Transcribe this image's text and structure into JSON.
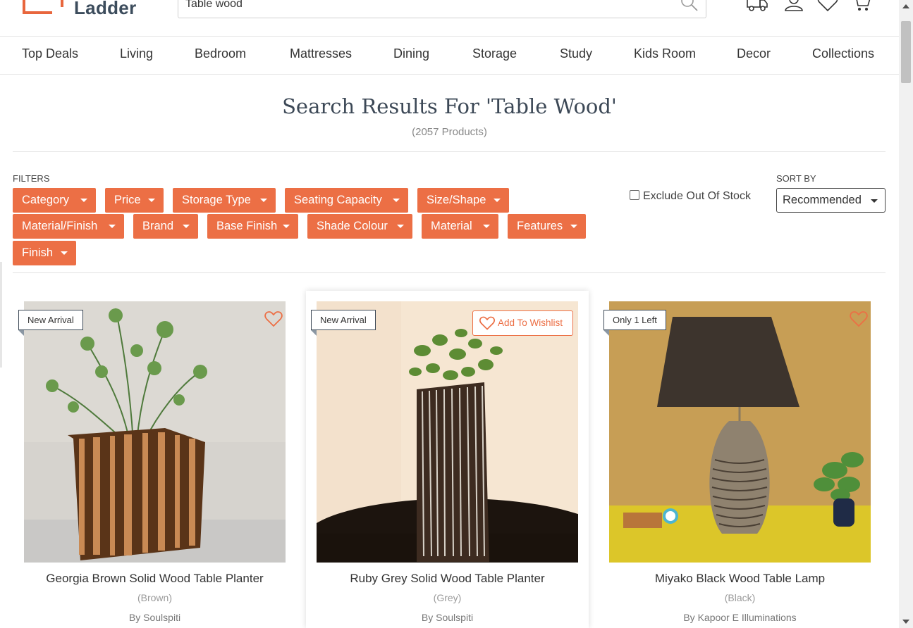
{
  "brand": {
    "logo_text": "Ladder",
    "accent_color": "#ec6f45",
    "text_color": "#3c4856"
  },
  "search": {
    "value": "Table wood",
    "icon": "search-icon"
  },
  "header_icons": [
    "truck-icon",
    "user-icon",
    "heart-icon",
    "cart-icon"
  ],
  "nav": [
    "Top Deals",
    "Living",
    "Bedroom",
    "Mattresses",
    "Dining",
    "Storage",
    "Study",
    "Kids Room",
    "Decor",
    "Collections"
  ],
  "results": {
    "title": "Search Results For 'Table Wood'",
    "count": "(2057 Products)"
  },
  "filters": {
    "label": "FILTERS",
    "chips": [
      "Category",
      "Price",
      "Storage Type",
      "Seating Capacity",
      "Size/Shape",
      "Material/Finish",
      "Brand",
      "Base Finish",
      "Shade Colour",
      "Material",
      "Features",
      "Finish"
    ]
  },
  "exclude_out_of_stock": {
    "label": "Exclude Out Of Stock",
    "checked": false
  },
  "sort": {
    "label": "SORT BY",
    "selected": "Recommended"
  },
  "products": [
    {
      "badge": "New Arrival",
      "name": "Georgia Brown Solid Wood Table Planter",
      "color": "(Brown)",
      "brand": "By Soulspiti"
    },
    {
      "badge": "New Arrival",
      "wishlist_label": "Add To Wishlist",
      "name": "Ruby Grey Solid Wood Table Planter",
      "color": "(Grey)",
      "brand": "By Soulspiti"
    },
    {
      "badge": "Only 1 Left",
      "name": "Miyako Black Wood Table Lamp",
      "color": "(Black)",
      "brand": "By Kapoor E Illuminations"
    }
  ]
}
